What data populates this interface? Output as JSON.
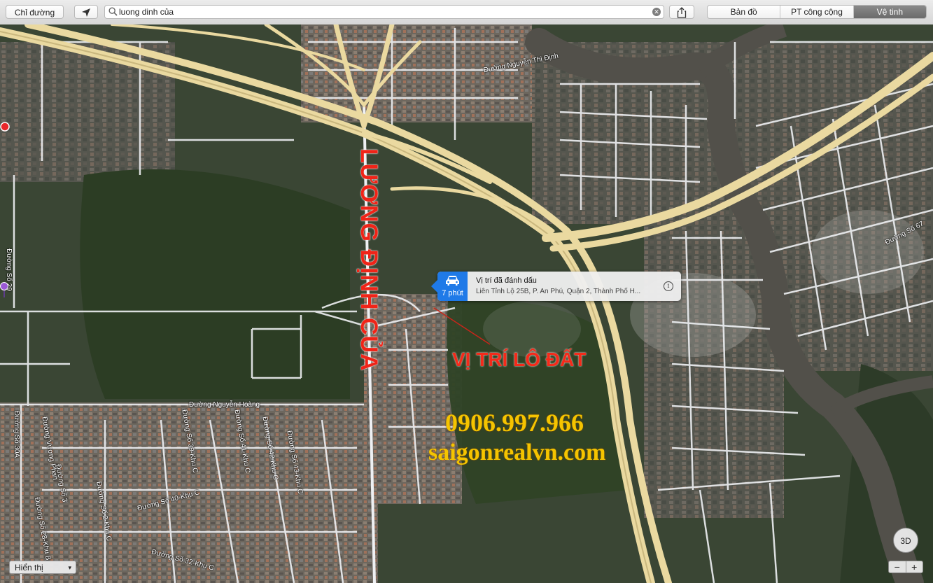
{
  "toolbar": {
    "directions_label": "Chỉ đường",
    "location_icon": "location-arrow-icon",
    "search_value": "luong dinh của",
    "share_icon": "share-icon",
    "map_modes": [
      {
        "label": "Bản đồ",
        "active": false
      },
      {
        "label": "PT công cộng",
        "active": false
      },
      {
        "label": "Vệ tinh",
        "active": true
      }
    ]
  },
  "callout": {
    "eta": "7 phút",
    "title": "Vị trí đã đánh dấu",
    "address": "Liên Tỉnh Lộ 25B, P. An Phú, Quận 2, Thành Phố H..."
  },
  "annotations": {
    "street_name": "LƯƠNG ĐỊNH CỦA",
    "lot_label": "VỊ TRÍ LÔ ĐẤT",
    "phone": "0906.997.966",
    "website": "saigonrealvn.com"
  },
  "street_labels": {
    "nguyen_thi_dinh": "Đường Nguyễn Thị Định",
    "nguyen_hoang": "Đường Nguyễn Hoàng",
    "duong_so_67": "Đường Số 67",
    "duong_so_29": "Đường Số 29",
    "duong_so_30a": "Đường Số 30A",
    "vuong_phan": "Đường Vương Phan",
    "duong_so_3": "Đường Số 3",
    "duong_so_40": "Đường Số 40-Khu C",
    "duong_so_32": "Đường Số 32-Khu C",
    "duong_so_39": "Đường Số 39-Khu C",
    "duong_so_41": "Đường Số 41-Khu C",
    "duong_so_42": "Đường Số 42-Khu C",
    "duong_so_43": "Đường Số 43-Khu C",
    "duong_so_2": "Đường Số 2-Khu C",
    "duong_so_28": "Đường Số 28-Khu B"
  },
  "controls": {
    "view_select": "Hiển thị",
    "btn_3d": "3D",
    "zoom_out": "−",
    "zoom_in": "+"
  },
  "colors": {
    "map_base": "#3a4634",
    "vegetation": "#2c3d24",
    "river": "#52504a",
    "road": "#eef0f3",
    "highway": "#ead9a0",
    "accent": "#1f7ae8",
    "annotation_red": "#f02418",
    "annotation_yellow": "#f5c400"
  }
}
